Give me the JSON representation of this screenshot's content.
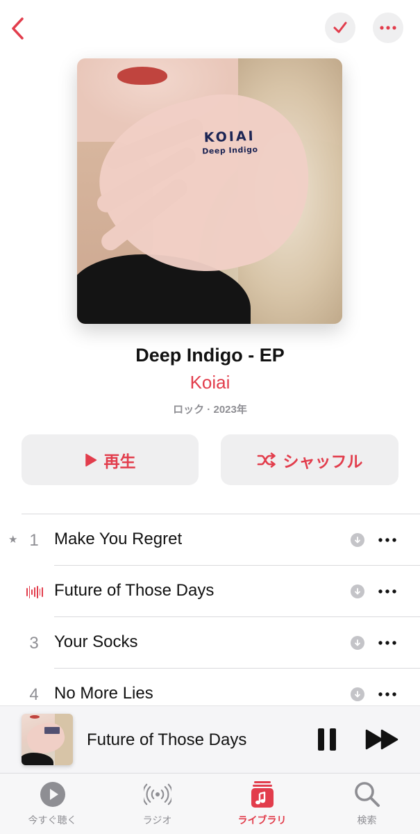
{
  "colors": {
    "accent": "#e23d4c",
    "secondary_text": "#8e8e93",
    "button_bg": "#efeff0"
  },
  "top_bar": {
    "back_icon": "chevron-left-icon",
    "check_icon": "checkmark-icon",
    "more_icon": "ellipsis-icon"
  },
  "artwork": {
    "logo_line1": "KOIAI",
    "logo_line2": "Deep Indigo"
  },
  "album": {
    "title": "Deep Indigo - EP",
    "artist": "Koiai",
    "meta": "ロック · 2023年"
  },
  "actions": {
    "play_label": "再生",
    "shuffle_label": "シャッフル"
  },
  "tracks": [
    {
      "number": "1",
      "title": "Make You Regret",
      "starred": true,
      "playing": false
    },
    {
      "number": "2",
      "title": "Future of Those Days",
      "starred": false,
      "playing": true
    },
    {
      "number": "3",
      "title": "Your Socks",
      "starred": false,
      "playing": false
    },
    {
      "number": "4",
      "title": "No More Lies",
      "starred": false,
      "playing": false
    }
  ],
  "mini_player": {
    "title": "Future of Those Days",
    "state": "playing"
  },
  "tabs": [
    {
      "label": "今すぐ聴く",
      "icon": "play-circle-icon",
      "active": false
    },
    {
      "label": "ラジオ",
      "icon": "radio-waves-icon",
      "active": false
    },
    {
      "label": "ライブラリ",
      "icon": "music-library-icon",
      "active": true
    },
    {
      "label": "検索",
      "icon": "magnifier-icon",
      "active": false
    }
  ]
}
